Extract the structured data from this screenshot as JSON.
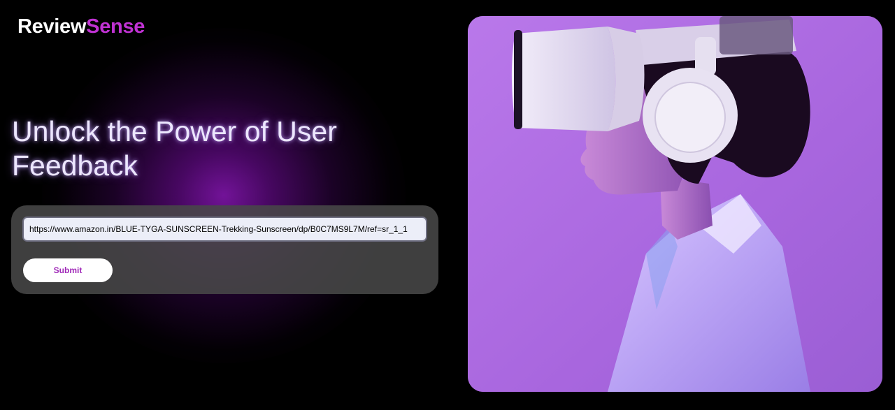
{
  "brand": {
    "name_primary": "Review",
    "name_accent": "Sense",
    "accent_color": "#c032d3"
  },
  "hero": {
    "headline": "Unlock the Power of User Feedback"
  },
  "form": {
    "url_value": "https://www.amazon.in/BLUE-TYGA-SUNSCREEN-Trekking-Sunscreen/dp/B0C7MS9L7M/ref=sr_1_1",
    "submit_label": "Submit"
  },
  "image": {
    "subject": "person-wearing-vr-headset",
    "background_color": "#b06ee6"
  }
}
